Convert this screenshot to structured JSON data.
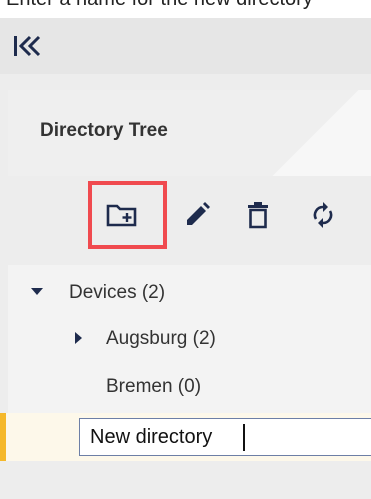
{
  "caption": {
    "text": "Enter a name for the new directory"
  },
  "sidebar": {
    "collapse_icon": "collapse-left-icon"
  },
  "panel": {
    "title": "Directory Tree"
  },
  "toolbar": {
    "items": [
      {
        "name": "new-folder",
        "icon": "folder-add-icon"
      },
      {
        "name": "rename",
        "icon": "pencil-icon"
      },
      {
        "name": "delete",
        "icon": "trash-icon"
      },
      {
        "name": "refresh",
        "icon": "sync-icon"
      }
    ]
  },
  "tree": {
    "root": {
      "label": "Devices (2)",
      "expanded": true
    },
    "children": [
      {
        "label": "Augsburg (2)",
        "expanded": false
      },
      {
        "label": "Bremen (0)"
      }
    ],
    "new_item": {
      "value": "New directory"
    }
  },
  "colors": {
    "accent": "#f5b82a",
    "highlight": "#f04a4f",
    "icon": "#1e2b4d",
    "selected_row": "#fdf8ea"
  }
}
